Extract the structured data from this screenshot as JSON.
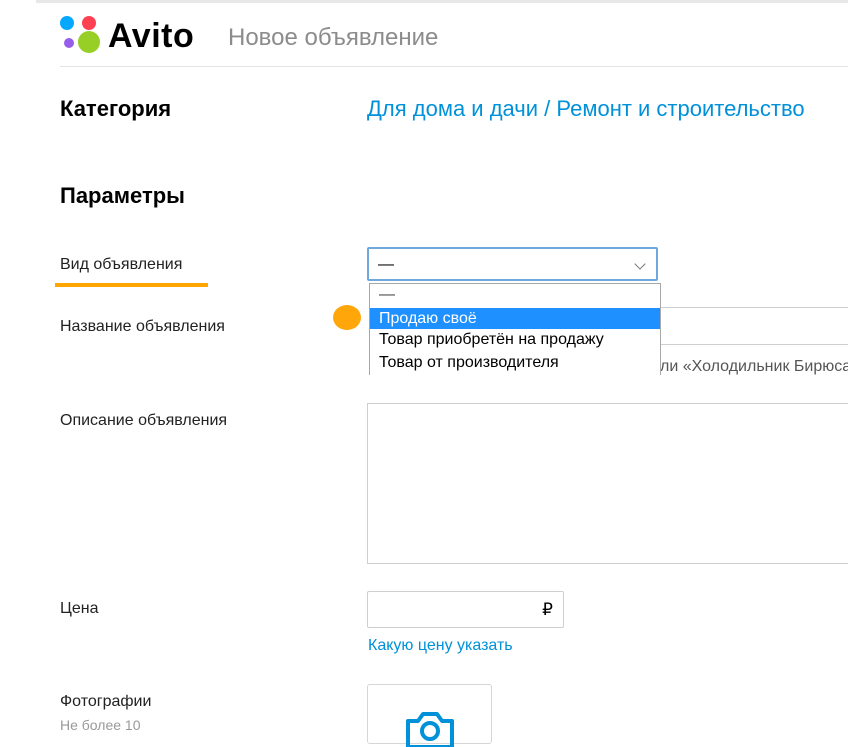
{
  "header": {
    "brand": "Avito",
    "page_title": "Новое объявление"
  },
  "category": {
    "label": "Категория",
    "path": "Для дома и дачи / Ремонт и строительство"
  },
  "params": {
    "label": "Параметры"
  },
  "fields": {
    "ad_type": {
      "label": "Вид объявления",
      "value": "—",
      "options": [
        "—",
        "Продаю своё",
        "Товар приобретён на продажу",
        "Товар от производителя"
      ],
      "selected_index": 1
    },
    "title": {
      "label": "Название объявления",
      "hint": "ли «Холодильник Бирюса»"
    },
    "description": {
      "label": "Описание объявления"
    },
    "price": {
      "label": "Цена",
      "currency": "₽",
      "help_link": "Какую цену указать"
    },
    "photos": {
      "label": "Фотографии",
      "sublabel": "Не более 10"
    }
  },
  "colors": {
    "accent": "#0091d9",
    "highlight": "#ffa500",
    "selected_option": "#1e90ff"
  },
  "icons": {
    "camera": "camera-icon",
    "chevron": "chevron-down-icon"
  }
}
